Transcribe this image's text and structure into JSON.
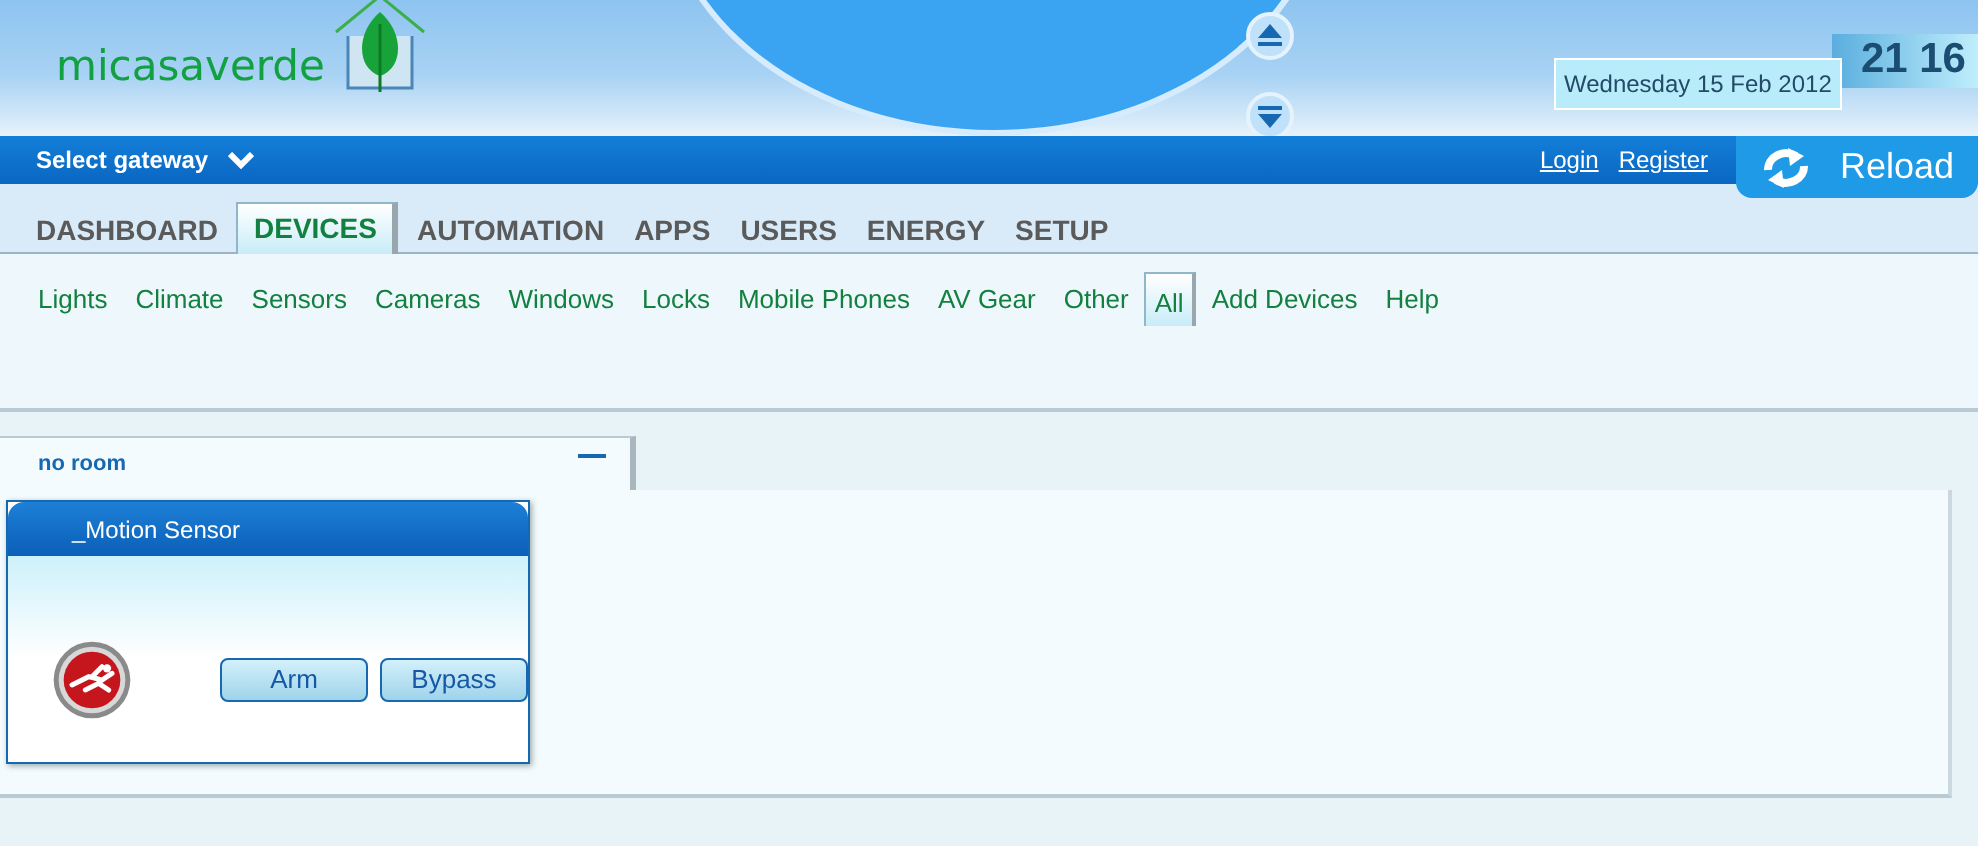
{
  "header": {
    "logo": "micasaverde",
    "date": "Wednesday 15 Feb 2012",
    "time": "21 16"
  },
  "gateway_bar": {
    "label": "Select gateway",
    "links": [
      "Login",
      "Register"
    ],
    "reload": "Reload"
  },
  "tabs": [
    {
      "label": "DASHBOARD",
      "selected": false
    },
    {
      "label": "DEVICES",
      "selected": true
    },
    {
      "label": "AUTOMATION",
      "selected": false
    },
    {
      "label": "APPS",
      "selected": false
    },
    {
      "label": "USERS",
      "selected": false
    },
    {
      "label": "ENERGY",
      "selected": false
    },
    {
      "label": "SETUP",
      "selected": false
    }
  ],
  "subtabs": [
    {
      "label": "Lights",
      "selected": false
    },
    {
      "label": "Climate",
      "selected": false
    },
    {
      "label": "Sensors",
      "selected": false
    },
    {
      "label": "Cameras",
      "selected": false
    },
    {
      "label": "Windows",
      "selected": false
    },
    {
      "label": "Locks",
      "selected": false
    },
    {
      "label": "Mobile Phones",
      "selected": false
    },
    {
      "label": "AV Gear",
      "selected": false
    },
    {
      "label": "Other",
      "selected": false
    },
    {
      "label": "All",
      "selected": true
    },
    {
      "label": "Add Devices",
      "selected": false
    },
    {
      "label": "Help",
      "selected": false
    }
  ],
  "room": {
    "name": "no room",
    "devices": [
      {
        "name": "_Motion Sensor",
        "buttons": [
          "Arm",
          "Bypass"
        ]
      }
    ]
  }
}
